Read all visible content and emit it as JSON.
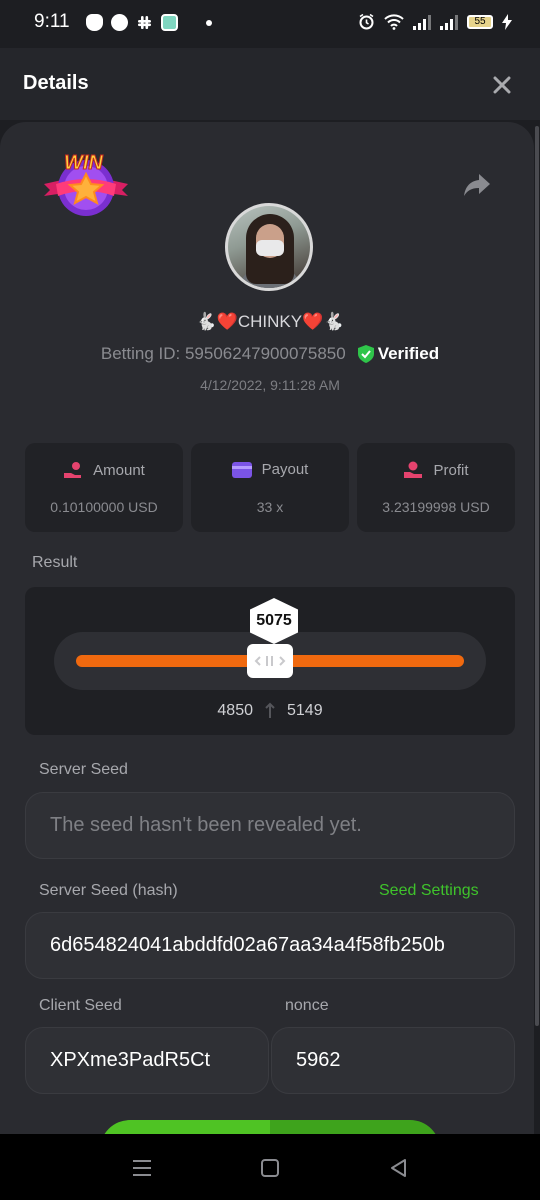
{
  "status_bar": {
    "time": "9:11",
    "battery": "55"
  },
  "header": {
    "title": "Details"
  },
  "bet": {
    "username": "🐇❤️CHINKY❤️🐇",
    "betting_id_label": "Betting ID: 59506247900075850",
    "verified_label": "Verified",
    "date": "4/12/2022, 9:11:28 AM",
    "win_badge": "WIN"
  },
  "stats": [
    {
      "label": "Amount",
      "value": "0.10100000 USD",
      "icon": "hand-coins-icon",
      "color": "#e5436e"
    },
    {
      "label": "Payout",
      "value": "33 x",
      "icon": "card-icon",
      "color": "#7b54e6"
    },
    {
      "label": "Profit",
      "value": "3.23199998 USD",
      "icon": "hand-money-icon",
      "color": "#e5436e"
    }
  ],
  "result": {
    "label": "Result",
    "value": "5075",
    "range_low": "4850",
    "range_high": "5149",
    "accent": "#f0690f"
  },
  "server_seed": {
    "label": "Server Seed",
    "placeholder": "The seed hasn't been revealed yet."
  },
  "server_seed_hash": {
    "label": "Server Seed (hash)",
    "settings_link": "Seed Settings",
    "value": "6d654824041abddfd02a67aa34a4f58fb250b"
  },
  "client_seed": {
    "label": "Client Seed",
    "value": "XPXme3PadR5Ct"
  },
  "nonce": {
    "label": "nonce",
    "value": "5962"
  },
  "colors": {
    "background": "#1d1e22",
    "card": "#2a2b30",
    "green": "#3fc32b"
  }
}
